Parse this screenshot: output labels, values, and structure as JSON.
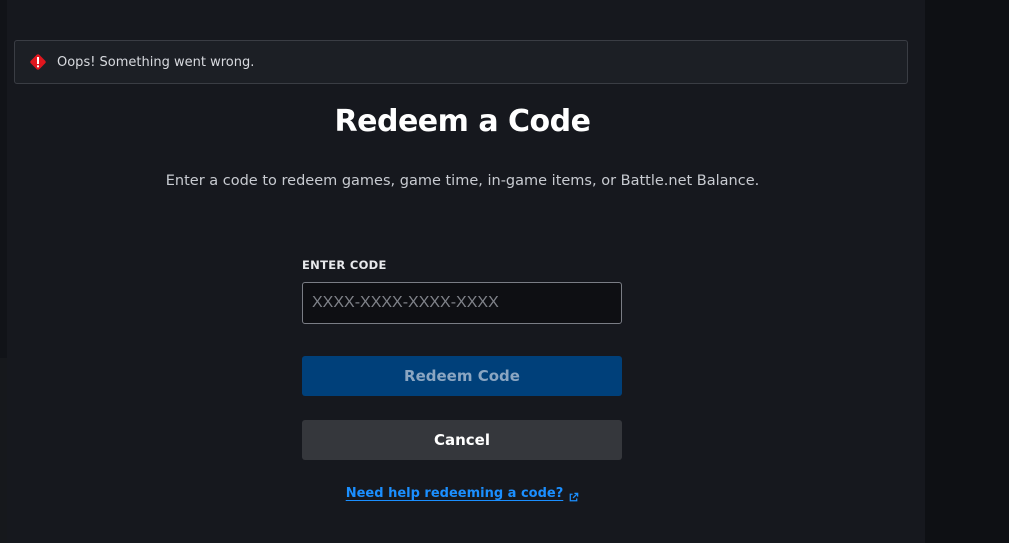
{
  "error": {
    "message": "Oops! Something went wrong.",
    "icon": "alert-diamond-icon",
    "color": "#e0161e"
  },
  "header": {
    "title": "Redeem a Code",
    "subtitle": "Enter a code to redeem games, game time, in-game items, or Battle.net Balance."
  },
  "form": {
    "label": "ENTER CODE",
    "value": "",
    "placeholder": "XXXX-XXXX-XXXX-XXXX"
  },
  "actions": {
    "redeem_label": "Redeem Code",
    "cancel_label": "Cancel",
    "help_label": "Need help redeeming a code?",
    "help_icon": "external-link-icon"
  },
  "colors": {
    "primary": "#00407a",
    "link": "#1b8fff",
    "background": "#16181e"
  }
}
